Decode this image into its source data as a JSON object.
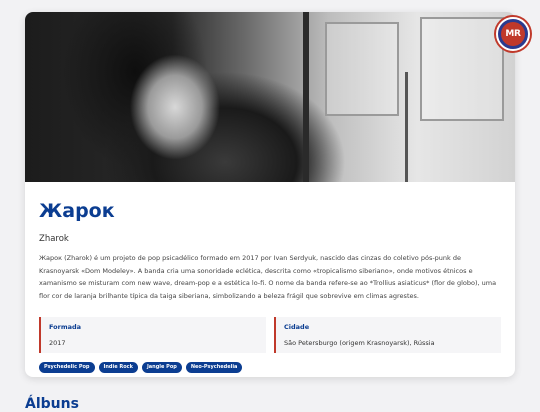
{
  "badge": {
    "text": "MR"
  },
  "artist": {
    "name": "Жарок",
    "latin_name": "Zharok",
    "description": "Жарок (Zharok) é um projeto de pop psicadélico formado em 2017 por Ivan Serdyuk, nascido das cinzas do coletivo pós-punk de Krasnoyarsk «Dom Modeley». A banda cria uma sonoridade eclética, descrita como «tropicalismo siberiano», onde motivos étnicos e xamanismo se misturam com new wave, dream-pop e a estética lo-fi. O nome da banda refere-se ao *Trollius asiaticus* (flor de globo), uma flor cor de laranja brilhante típica da taiga siberiana, simbolizando a beleza frágil que sobrevive em climas agrestes."
  },
  "facts": {
    "formed_label": "Formada",
    "formed_value": "2017",
    "city_label": "Cidade",
    "city_value": "São Petersburgo (origem Krasnoyarsk), Rússia"
  },
  "tags": [
    "Psychedelic Pop",
    "Indie Rock",
    "Jangle Pop",
    "Neo-Psychedelia"
  ],
  "sections": {
    "albums_title": "Álbuns"
  },
  "colors": {
    "accent": "#0b3d91",
    "badge_ring": "#c0392b",
    "page_bg": "#f2f2f4"
  }
}
